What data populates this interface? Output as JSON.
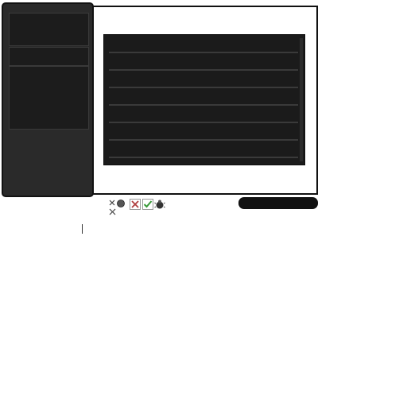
{
  "window": {
    "side_boxes": [
      "panel-1",
      "panel-2",
      "panel-3"
    ],
    "list_rows": 7
  },
  "toolbar": {
    "icons": [
      "close-small-icon",
      "dot-icon",
      "delete-icon",
      "check-icon",
      "bug-icon"
    ]
  },
  "colors": {
    "panel_dark": "#2a2a2a",
    "list_bg": "#1b1b1b",
    "frame_border": "#111111",
    "check_green": "#3a9a3a",
    "delete_red": "#b04040"
  }
}
